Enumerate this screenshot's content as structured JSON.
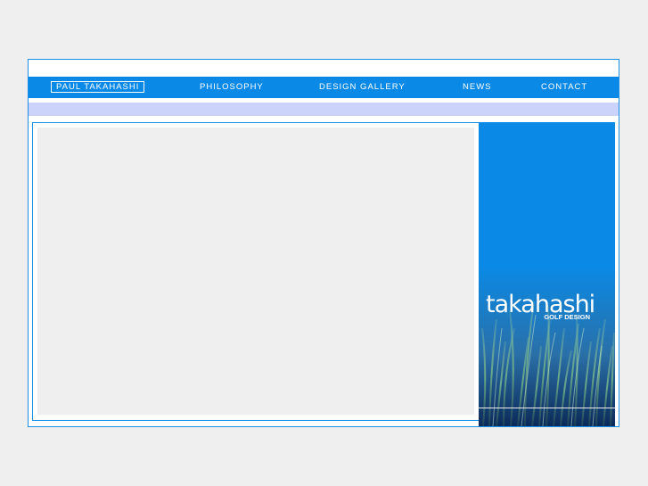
{
  "nav": {
    "items": [
      {
        "label": "PAUL TAKAHASHI",
        "active": true
      },
      {
        "label": "PHILOSOPHY",
        "active": false
      },
      {
        "label": "DESIGN GALLERY",
        "active": false
      },
      {
        "label": "NEWS",
        "active": false
      },
      {
        "label": "CONTACT",
        "active": false
      }
    ]
  },
  "brand": {
    "name": "takahashi",
    "subtitle": "GOLF DESIGN"
  },
  "colors": {
    "accent": "#0a8ae6",
    "lavender_bar": "#cbd3fb",
    "background": "#efefef"
  }
}
